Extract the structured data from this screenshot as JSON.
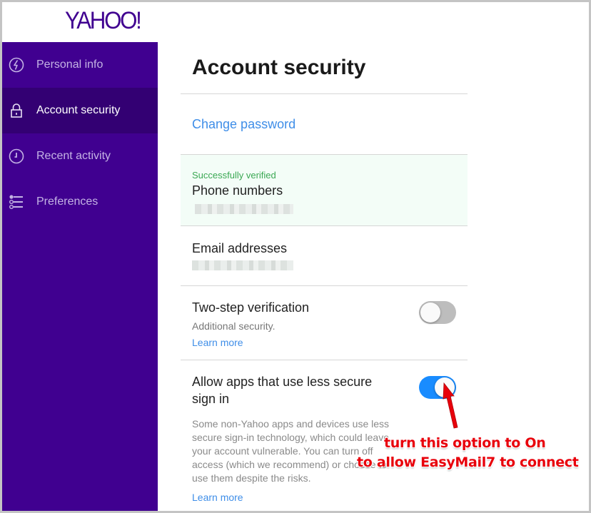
{
  "brand": {
    "logo_text": "YAHOO!",
    "color": "#400090"
  },
  "sidebar": {
    "items": [
      {
        "label": "Personal info",
        "icon": "lightning-circle-icon",
        "active": false
      },
      {
        "label": "Account security",
        "icon": "lock-icon",
        "active": true
      },
      {
        "label": "Recent activity",
        "icon": "clock-icon",
        "active": false
      },
      {
        "label": "Preferences",
        "icon": "sliders-list-icon",
        "active": false
      }
    ]
  },
  "main": {
    "title": "Account security",
    "change_password": "Change password",
    "phone": {
      "status": "Successfully verified",
      "title": "Phone numbers",
      "value_redacted": true
    },
    "email": {
      "title": "Email addresses",
      "value_redacted": true
    },
    "two_step": {
      "title": "Two-step verification",
      "subtitle": "Additional security.",
      "learn_more": "Learn more",
      "enabled": false
    },
    "less_secure": {
      "title_line1": "Allow apps that use less secure",
      "title_line2": "sign in",
      "description": "Some non-Yahoo apps and devices use less secure sign-in technology, which could leave your account vulnerable. You can turn off access (which we recommend) or choose to use them despite the risks.",
      "learn_more": "Learn more",
      "enabled": true
    }
  },
  "annotation": {
    "line1": "turn this option to On",
    "line2": "to allow EasyMail7 to connect",
    "color": "#e8000b"
  },
  "colors": {
    "sidebar_bg": "#400090",
    "sidebar_active_bg": "#330073",
    "link": "#3f8ee8",
    "toggle_on": "#198cff",
    "toggle_off": "#bdbdbd",
    "verified": "#3aa853"
  }
}
